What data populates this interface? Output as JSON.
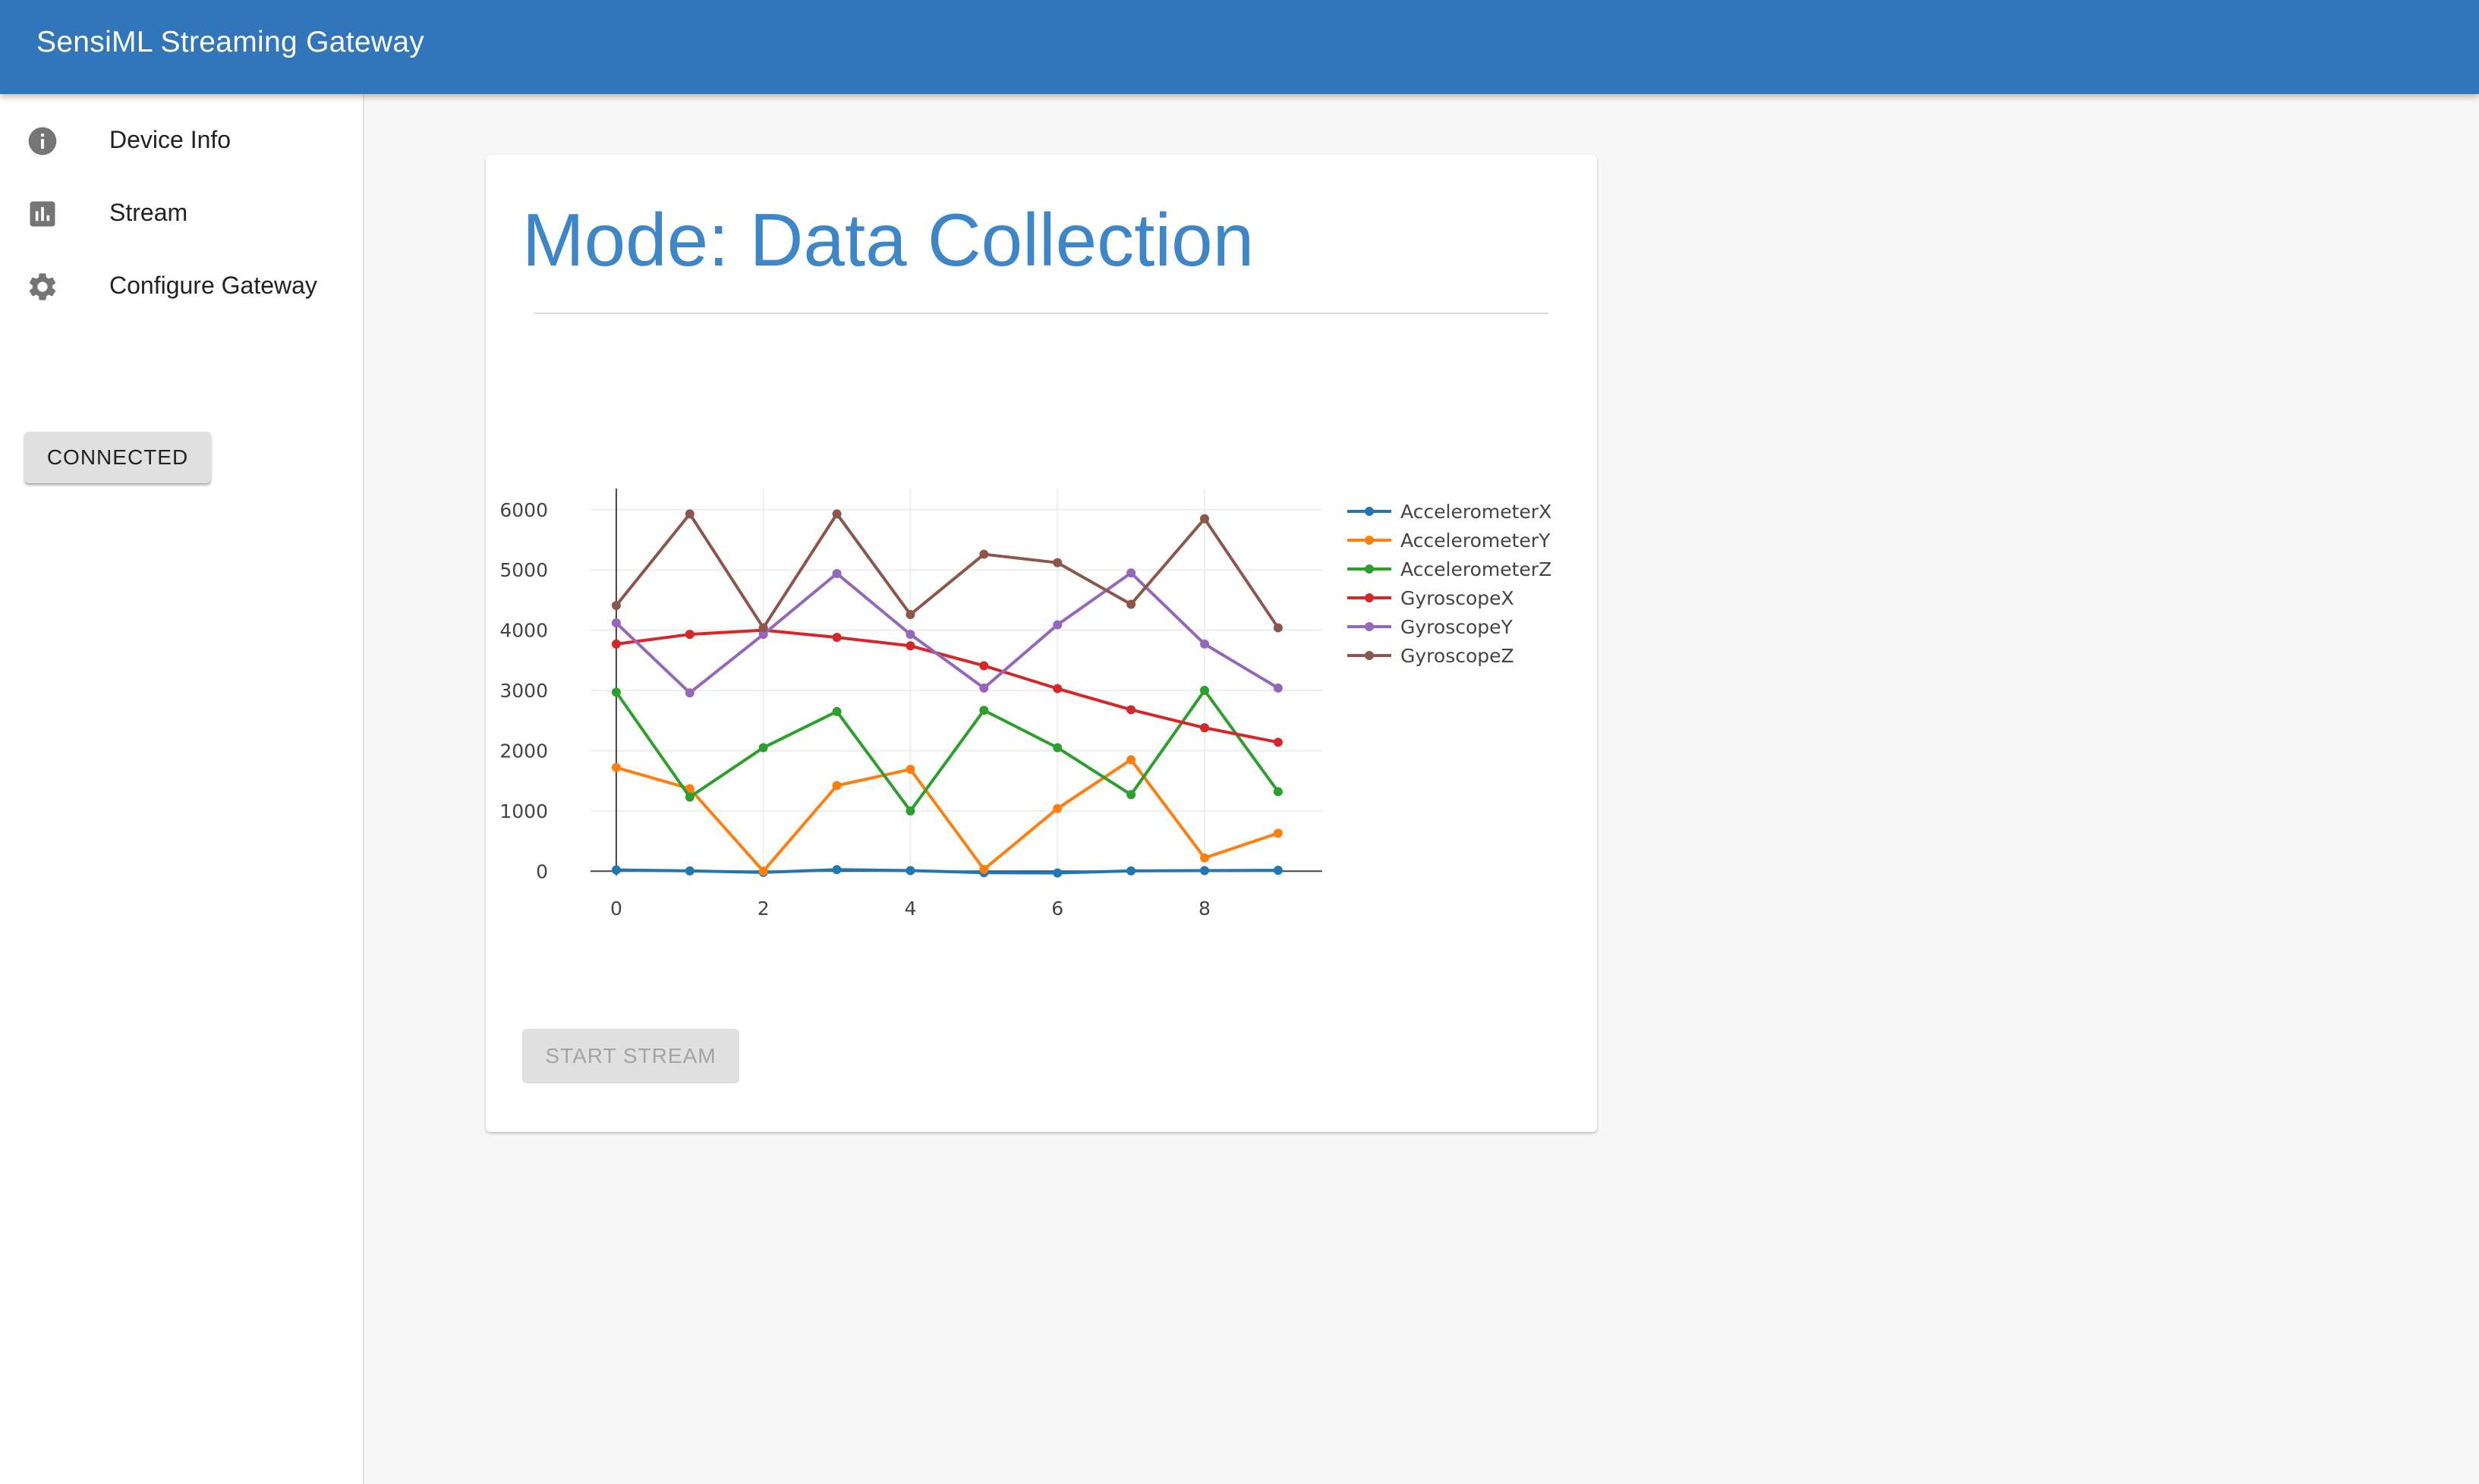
{
  "app": {
    "title": "SensiML Streaming Gateway"
  },
  "sidebar": {
    "items": [
      {
        "label": "Device Info",
        "icon": "info-icon"
      },
      {
        "label": "Stream",
        "icon": "bar-chart-icon"
      },
      {
        "label": "Configure Gateway",
        "icon": "gear-icon"
      }
    ],
    "connection_button": "CONNECTED"
  },
  "main": {
    "mode_title": "Mode: Data Collection",
    "start_button": "START STREAM"
  },
  "chart_data": {
    "type": "line",
    "x": [
      0,
      1,
      2,
      3,
      4,
      5,
      6,
      7,
      8,
      9
    ],
    "xticks": [
      0,
      2,
      4,
      6,
      8
    ],
    "yticks": [
      0,
      1000,
      2000,
      3000,
      4000,
      5000,
      6000
    ],
    "xlim": [
      -0.35,
      9.6
    ],
    "ylim": [
      -450,
      6350
    ],
    "grid": true,
    "legend_position": "right",
    "series": [
      {
        "name": "AccelerometerX",
        "color": "#1f77b4",
        "values": [
          20,
          5,
          -20,
          25,
          10,
          -25,
          -30,
          5,
          10,
          15
        ]
      },
      {
        "name": "AccelerometerY",
        "color": "#ff7f0e",
        "values": [
          1720,
          1370,
          0,
          1420,
          1690,
          30,
          1040,
          1850,
          220,
          630
        ]
      },
      {
        "name": "AccelerometerZ",
        "color": "#2ca02c",
        "values": [
          2970,
          1230,
          2050,
          2650,
          1000,
          2670,
          2050,
          1270,
          3000,
          1320
        ]
      },
      {
        "name": "GyroscopeX",
        "color": "#d62728",
        "values": [
          3770,
          3930,
          4000,
          3880,
          3740,
          3410,
          3030,
          2680,
          2380,
          2140
        ]
      },
      {
        "name": "GyroscopeY",
        "color": "#9467bd",
        "values": [
          4120,
          2960,
          3930,
          4940,
          3930,
          3040,
          4090,
          4950,
          3770,
          3040
        ]
      },
      {
        "name": "GyroscopeZ",
        "color": "#8c564b",
        "values": [
          4410,
          5930,
          4040,
          5930,
          4260,
          5260,
          5120,
          4430,
          5850,
          4040
        ]
      }
    ]
  }
}
